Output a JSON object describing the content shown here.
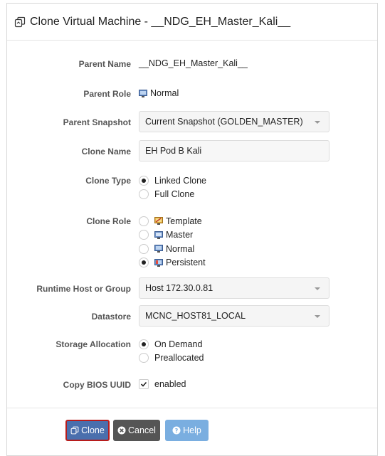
{
  "dialog": {
    "title": "Clone Virtual Machine - __NDG_EH_Master_Kali__"
  },
  "form": {
    "parent_name": {
      "label": "Parent Name",
      "value": "__NDG_EH_Master_Kali__"
    },
    "parent_role": {
      "label": "Parent Role",
      "value": "Normal",
      "icon": "monitor-icon"
    },
    "parent_snapshot": {
      "label": "Parent Snapshot",
      "value": "Current Snapshot (GOLDEN_MASTER)"
    },
    "clone_name": {
      "label": "Clone Name",
      "value": "EH Pod B Kali"
    },
    "clone_type": {
      "label": "Clone Type",
      "options": [
        {
          "label": "Linked Clone",
          "selected": true
        },
        {
          "label": "Full Clone",
          "selected": false
        }
      ]
    },
    "clone_role": {
      "label": "Clone Role",
      "options": [
        {
          "label": "Template",
          "selected": false,
          "icon": "template-icon"
        },
        {
          "label": "Master",
          "selected": false,
          "icon": "master-monitor-icon"
        },
        {
          "label": "Normal",
          "selected": false,
          "icon": "monitor-icon"
        },
        {
          "label": "Persistent",
          "selected": true,
          "icon": "persistent-icon"
        }
      ]
    },
    "runtime_host": {
      "label": "Runtime Host or Group",
      "value": "Host 172.30.0.81"
    },
    "datastore": {
      "label": "Datastore",
      "value": "MCNC_HOST81_LOCAL"
    },
    "storage_allocation": {
      "label": "Storage Allocation",
      "options": [
        {
          "label": "On Demand",
          "selected": true
        },
        {
          "label": "Preallocated",
          "selected": false
        }
      ]
    },
    "copy_bios_uuid": {
      "label": "Copy BIOS UUID",
      "value": "enabled",
      "checked": true
    }
  },
  "footer": {
    "clone_label": "Clone",
    "cancel_label": "Cancel",
    "help_label": "Help"
  },
  "colors": {
    "clone_button": "#4a6fad",
    "clone_highlight_border": "#b71c1c",
    "cancel_button": "#555555",
    "help_button": "#7aaee0"
  }
}
